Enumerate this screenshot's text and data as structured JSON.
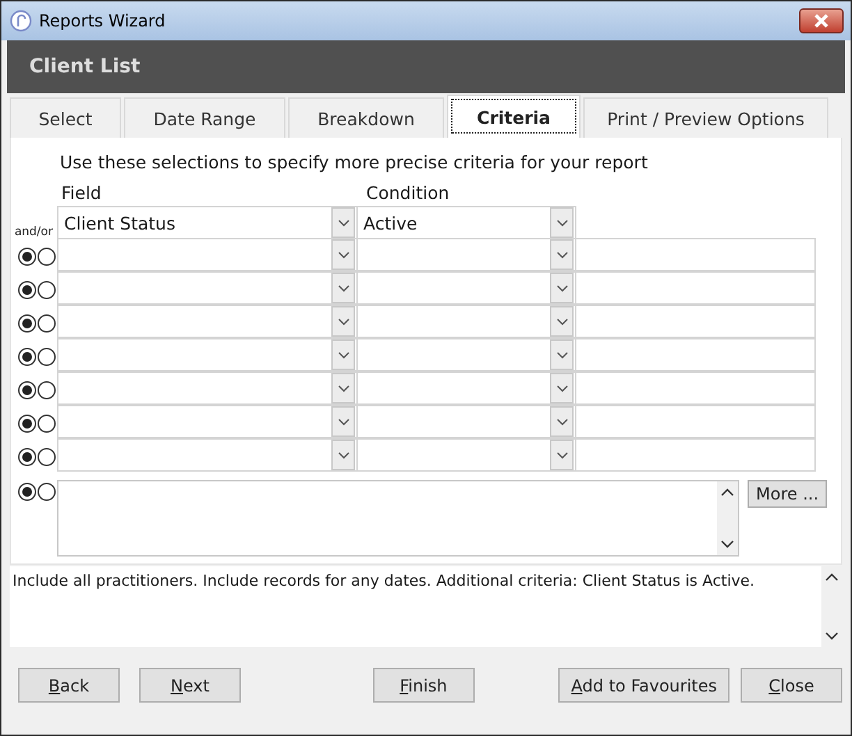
{
  "window": {
    "title": "Reports Wizard"
  },
  "header": "Client List",
  "tabs": [
    {
      "label": "Select",
      "selected": false
    },
    {
      "label": "Date Range",
      "selected": false
    },
    {
      "label": "Breakdown",
      "selected": false
    },
    {
      "label": "Criteria",
      "selected": true
    },
    {
      "label": "Print / Preview Options",
      "selected": false
    }
  ],
  "instructions": "Use these selections to specify more precise criteria for your report",
  "columns": {
    "field": "Field",
    "condition": "Condition",
    "andor": "and/or"
  },
  "first_row": {
    "field": "Client Status",
    "condition": "Active"
  },
  "rows": [
    {
      "options": [
        {
          "selected": true
        },
        {
          "selected": false
        }
      ]
    },
    {
      "options": [
        {
          "selected": true
        },
        {
          "selected": false
        }
      ]
    },
    {
      "options": [
        {
          "selected": true
        },
        {
          "selected": false
        }
      ]
    },
    {
      "options": [
        {
          "selected": true
        },
        {
          "selected": false
        }
      ]
    },
    {
      "options": [
        {
          "selected": true
        },
        {
          "selected": false
        }
      ]
    },
    {
      "options": [
        {
          "selected": true
        },
        {
          "selected": false
        }
      ]
    },
    {
      "options": [
        {
          "selected": true
        },
        {
          "selected": false
        }
      ]
    }
  ],
  "extra_row": {
    "options": [
      {
        "selected": true
      },
      {
        "selected": false
      }
    ],
    "more_button": "More ..."
  },
  "summary": "Include all practitioners. Include records for any dates. Additional criteria: Client Status is Active.",
  "buttons": {
    "left": [
      {
        "label": "Back",
        "underline_first": true
      },
      {
        "label": "Next",
        "underline_first": true
      }
    ],
    "center": [
      {
        "label": "Finish",
        "underline_first": true
      }
    ],
    "right": [
      {
        "label": "Add to Favourites",
        "underline_first": true
      },
      {
        "label": "Close",
        "underline_first": true
      }
    ]
  }
}
